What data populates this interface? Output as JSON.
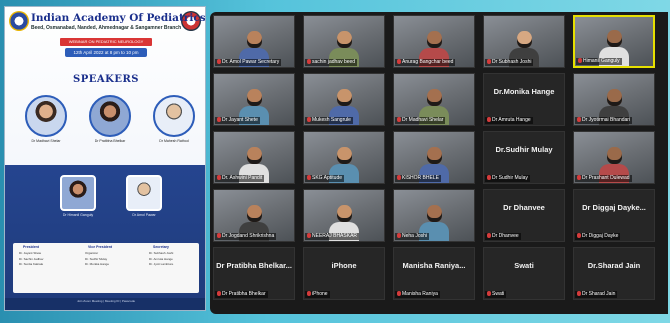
{
  "poster": {
    "title": "Indian Academy Of Pediatrics",
    "branch": "Beed, Osmanabad, Nanded, Ahmednagar & Sangamner Branch",
    "banner": "WEBINAR ON PEDIATRIC NEUROLOGY",
    "date": "12th April 2022 at 8 pm to 10 pm",
    "speakers_heading": "SPEAKERS",
    "speakers": [
      {
        "caption": "Dr Madhavi Shelar"
      },
      {
        "caption": "Dr Pratibha Bhelkar"
      },
      {
        "caption": "Dr Mahesh Rathod"
      },
      {
        "caption": "Dr Himanil Ganguly"
      },
      {
        "caption": "Dr Amol Pawar"
      }
    ],
    "panel_headings": [
      "President",
      "Vice President",
      "Secretary"
    ],
    "panel_cols": [
      "Dr. Jayant Shete\nDr. Sachin Jadhav\nDr. Sunita Kakrale",
      "Organizer\nDr. Sudhir Mulay\nDr. Monika Hange",
      "Dr. Subhash Joshi\nDr. Amruta Hange\nDr. Jyoti Lambture"
    ],
    "footer": "Join Zoom Meeting  |  Meeting ID  |  Passcode"
  },
  "meeting": {
    "tiles": [
      {
        "label": "Dr. Amol Pawar Secretary",
        "kind": "video"
      },
      {
        "label": "sachin jadhav beed",
        "kind": "video"
      },
      {
        "label": "Anurag Bangchar beed",
        "kind": "video"
      },
      {
        "label": "Dr Subhash Joshi",
        "kind": "video"
      },
      {
        "label": "Himanil Ganguly",
        "kind": "video",
        "active": true
      },
      {
        "label": "Dr Jayant Shete",
        "kind": "video"
      },
      {
        "label": "Mukesh Sangrule",
        "kind": "video"
      },
      {
        "label": "Dr Madhavi Shelar",
        "kind": "video"
      },
      {
        "label": "Dr Amruta Hange",
        "big": "Dr.Monika Hange",
        "kind": "name"
      },
      {
        "label": "Dr Jyotirmai Bhandari",
        "kind": "video"
      },
      {
        "label": "Dr. Ashwini Pandit",
        "kind": "video"
      },
      {
        "label": "SKG Aptitude",
        "kind": "video"
      },
      {
        "label": "KISHOR BHELE",
        "kind": "video"
      },
      {
        "label": "Dr Sudhir Mulay",
        "big": "Dr.Sudhir Mulay",
        "kind": "name"
      },
      {
        "label": "Dr Prashant Dulewad",
        "kind": "video"
      },
      {
        "label": "Dr Jogdand Shrikrishna",
        "kind": "video"
      },
      {
        "label": "NEERAJ BHASKAR",
        "kind": "video"
      },
      {
        "label": "Neha Joshi",
        "kind": "video"
      },
      {
        "label": "Dr Dhanvee",
        "big": "Dr Dhanvee",
        "kind": "name"
      },
      {
        "label": "Dr Diggaj Dayke",
        "big": "Dr Diggaj Dayke...",
        "kind": "name"
      },
      {
        "label": "Dr Pratibha Bhelkar",
        "big": "Dr Pratibha Bhelkar...",
        "kind": "name"
      },
      {
        "label": "iPhone",
        "big": "iPhone",
        "kind": "name"
      },
      {
        "label": "Manisha Raniya",
        "big": "Manisha Raniya...",
        "kind": "name"
      },
      {
        "label": "Swati",
        "big": "Swati",
        "kind": "name"
      },
      {
        "label": "Dr Sharad Jain",
        "big": "Dr.Sharad Jain",
        "kind": "name"
      }
    ]
  }
}
